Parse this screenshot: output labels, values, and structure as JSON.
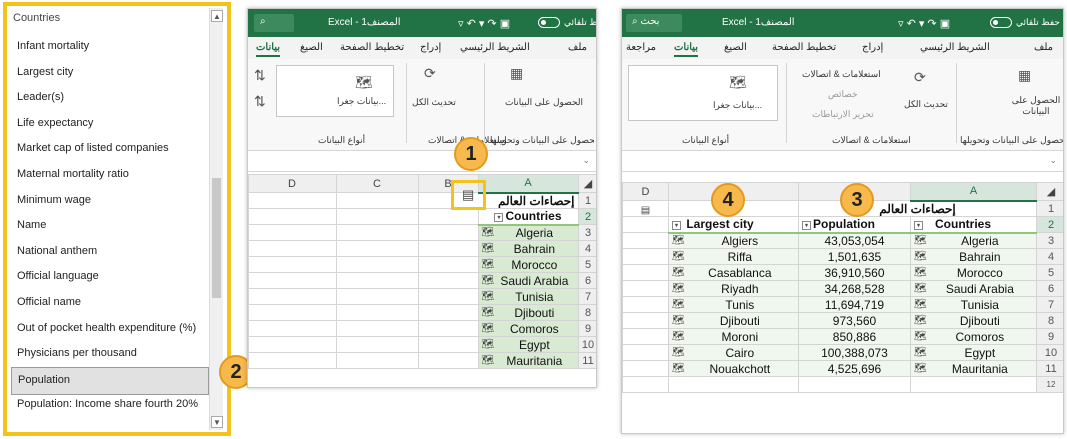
{
  "field_list": {
    "header": "Countries",
    "items": [
      "Infant mortality",
      "Largest city",
      "Leader(s)",
      "Life expectancy",
      "Market cap of listed companies",
      "Maternal mortality ratio",
      "Minimum wage",
      "Name",
      "National anthem",
      "Official language",
      "Official name",
      "Out of pocket health expenditure (%)",
      "Physicians per thousand",
      "Population",
      "Population: Income share fourth 20%"
    ],
    "selected_index": 13,
    "scroll_up": "▲",
    "scroll_down": "▼"
  },
  "callouts": [
    "1",
    "2",
    "3",
    "4"
  ],
  "window1": {
    "autosave": "حفظ تلقائي",
    "title": "Excel - المصنف1",
    "search_icon": "⌕",
    "tabs": [
      "ملف",
      "الشريط الرئيسي",
      "إدراج",
      "تخطيط الصفحة",
      "الصيغ",
      "بيانات"
    ],
    "ribbon": {
      "get_data": "الحصول على البيانات",
      "refresh": "تحديث الكل",
      "geo": "بيانات جغرا...",
      "group1": "الحصول على البيانات وتحويلها",
      "group2": "استعلامات & اتصالات",
      "group3": "أنواع البيانات"
    },
    "columns": [
      "D",
      "C",
      "B",
      "A"
    ],
    "rows": [
      "1",
      "2",
      "3",
      "4",
      "5",
      "6",
      "7",
      "8",
      "9",
      "10",
      "11"
    ],
    "title_cell": "إحصاءات العالم",
    "header": "Countries",
    "countries": [
      "Algeria",
      "Bahrain",
      "Morocco",
      "Saudi Arabia",
      "Tunisia",
      "Djibouti",
      "Comoros",
      "Egypt",
      "Mauritania"
    ]
  },
  "window2": {
    "autosave": "حفظ تلقائي",
    "title": "Excel - المصنف1",
    "search_label": "بحث",
    "tabs": [
      "ملف",
      "الشريط الرئيسي",
      "إدراج",
      "تخطيط الصفحة",
      "الصيغ",
      "بيانات",
      "مراجعة"
    ],
    "ribbon": {
      "get_data": "الحصول على البيانات",
      "refresh": "تحديث الكل",
      "queries": "استعلامات & اتصالات",
      "properties": "خصائص",
      "edit_links": "تحرير الارتباطات",
      "geo": "بيانات جغرا...",
      "group1": "الحصول على البيانات وتحويلها",
      "group2": "استعلامات & اتصالات",
      "group3": "أنواع البيانات"
    },
    "columns": [
      "D",
      "",
      "",
      "A"
    ],
    "rows": [
      "1",
      "2",
      "3",
      "4",
      "5",
      "6",
      "7",
      "8",
      "9",
      "10",
      "11",
      "12"
    ],
    "title_cell": "إحصاءات العالم",
    "headers": {
      "largest_city": "Largest city",
      "population": "Population",
      "countries": "Countries"
    },
    "table": [
      {
        "city": "Algiers",
        "pop": "43,053,054",
        "country": "Algeria"
      },
      {
        "city": "Riffa",
        "pop": "1,501,635",
        "country": "Bahrain"
      },
      {
        "city": "Casablanca",
        "pop": "36,910,560",
        "country": "Morocco"
      },
      {
        "city": "Riyadh",
        "pop": "34,268,528",
        "country": "Saudi Arabia"
      },
      {
        "city": "Tunis",
        "pop": "11,694,719",
        "country": "Tunisia"
      },
      {
        "city": "Djibouti",
        "pop": "973,560",
        "country": "Djibouti"
      },
      {
        "city": "Moroni",
        "pop": "850,886",
        "country": "Comoros"
      },
      {
        "city": "Cairo",
        "pop": "100,388,073",
        "country": "Egypt"
      },
      {
        "city": "Nouakchott",
        "pop": "4,525,696",
        "country": "Mauritania"
      }
    ]
  },
  "colors": {
    "excel_green": "#217346",
    "highlight": "#f2c31b",
    "callout": "#f7b94c",
    "table_green": "#d9ead3"
  }
}
